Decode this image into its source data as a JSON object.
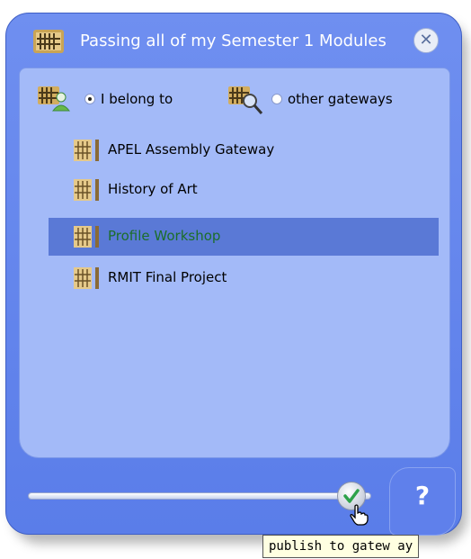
{
  "window": {
    "title": "Passing all of my Semester 1 Modules",
    "close_icon": "close-icon"
  },
  "filter": {
    "option_belong": {
      "label": "I belong to",
      "selected": true,
      "icon": "gateway-user-icon"
    },
    "option_other": {
      "label": "other gateways",
      "selected": false,
      "icon": "gateway-search-icon"
    }
  },
  "gateways": [
    {
      "label": "APEL Assembly Gateway",
      "selected": false
    },
    {
      "label": "History of Art",
      "selected": false
    },
    {
      "label": "Profile Workshop",
      "selected": true
    },
    {
      "label": "RMIT Final Project",
      "selected": false
    }
  ],
  "slider": {
    "value": 1,
    "knob_icon": "checkmark-icon"
  },
  "help": {
    "label": "?"
  },
  "tooltip": {
    "text": "publish to gatew ay"
  },
  "colors": {
    "panel": "#5a7de9",
    "inner": "#a3baf8",
    "selected_row": "#5a79d6",
    "selected_text": "#1c6e2a",
    "check": "#2ea24a"
  }
}
